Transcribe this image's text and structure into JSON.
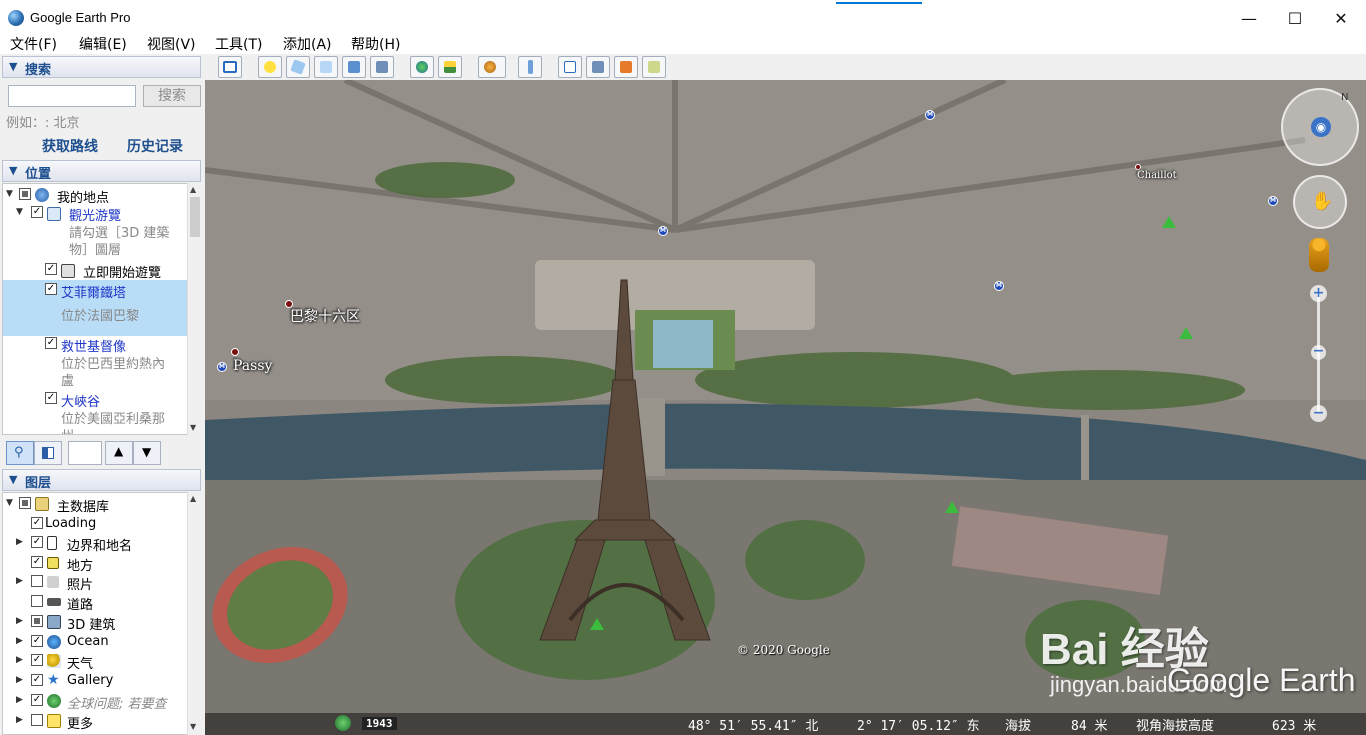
{
  "window": {
    "title": "Google Earth Pro"
  },
  "window_buttons": {
    "minimize": "—",
    "maximize": "☐",
    "close": "✕"
  },
  "menu": [
    "文件(F)",
    "编辑(E)",
    "视图(V)",
    "工具(T)",
    "添加(A)",
    "帮助(H)"
  ],
  "search_panel": {
    "header": "搜索",
    "input_value": "",
    "button": "搜索",
    "hint": "例如：: 北京",
    "get_directions": "获取路线",
    "history": "历史记录"
  },
  "places_panel": {
    "header": "位置",
    "items": [
      {
        "label": "我的地点"
      },
      {
        "label": "觀光游覽",
        "link": true
      },
      {
        "label": "請勾選［3D 建築",
        "sub": true
      },
      {
        "label": "物］圖層",
        "sub": true
      },
      {
        "label": "立即開始遊覽"
      },
      {
        "label": "艾菲爾鐵塔",
        "link": true
      },
      {
        "label": "位於法國巴黎",
        "sub": true
      },
      {
        "label": "救世基督像",
        "link": true
      },
      {
        "label": "位於巴西里約熱內",
        "sub": true
      },
      {
        "label": "盧",
        "sub": true
      },
      {
        "label": "大峽谷",
        "link": true
      },
      {
        "label": "位於美國亞利桑那",
        "sub": true
      },
      {
        "label": "州",
        "sub": true
      }
    ]
  },
  "layers_panel": {
    "header": "图层",
    "items": [
      {
        "label": "主数据库"
      },
      {
        "label": "Loading"
      },
      {
        "label": "边界和地名"
      },
      {
        "label": "地方"
      },
      {
        "label": "照片"
      },
      {
        "label": "道路"
      },
      {
        "label": "3D 建筑"
      },
      {
        "label": "Ocean"
      },
      {
        "label": "天气"
      },
      {
        "label": "Gallery"
      },
      {
        "label": "全球问题; 若要查",
        "sub": true
      },
      {
        "label": "更多"
      }
    ]
  },
  "map": {
    "labels": {
      "paris16": "巴黎十六区",
      "passy": "Passy",
      "chaillot": "Chaillot"
    },
    "copyright": "© 2020 Google",
    "watermark": "Bai 经验",
    "watermark_sub": "jingyan.baidu.com",
    "brand": "Google Earth",
    "year": "1943"
  },
  "status": {
    "lat": "48° 51′ 55.41″ 北",
    "lon": "2° 17′ 05.12″ 东",
    "altitude_label": "海拔",
    "altitude": "84 米",
    "eye_label": "视角海拔高度",
    "eye": "623 米"
  },
  "colors": {
    "accent": "#0078d7",
    "panel_header_text": "#1e4f8e",
    "link": "#1f37c8",
    "selection": "#b9dcf7"
  }
}
